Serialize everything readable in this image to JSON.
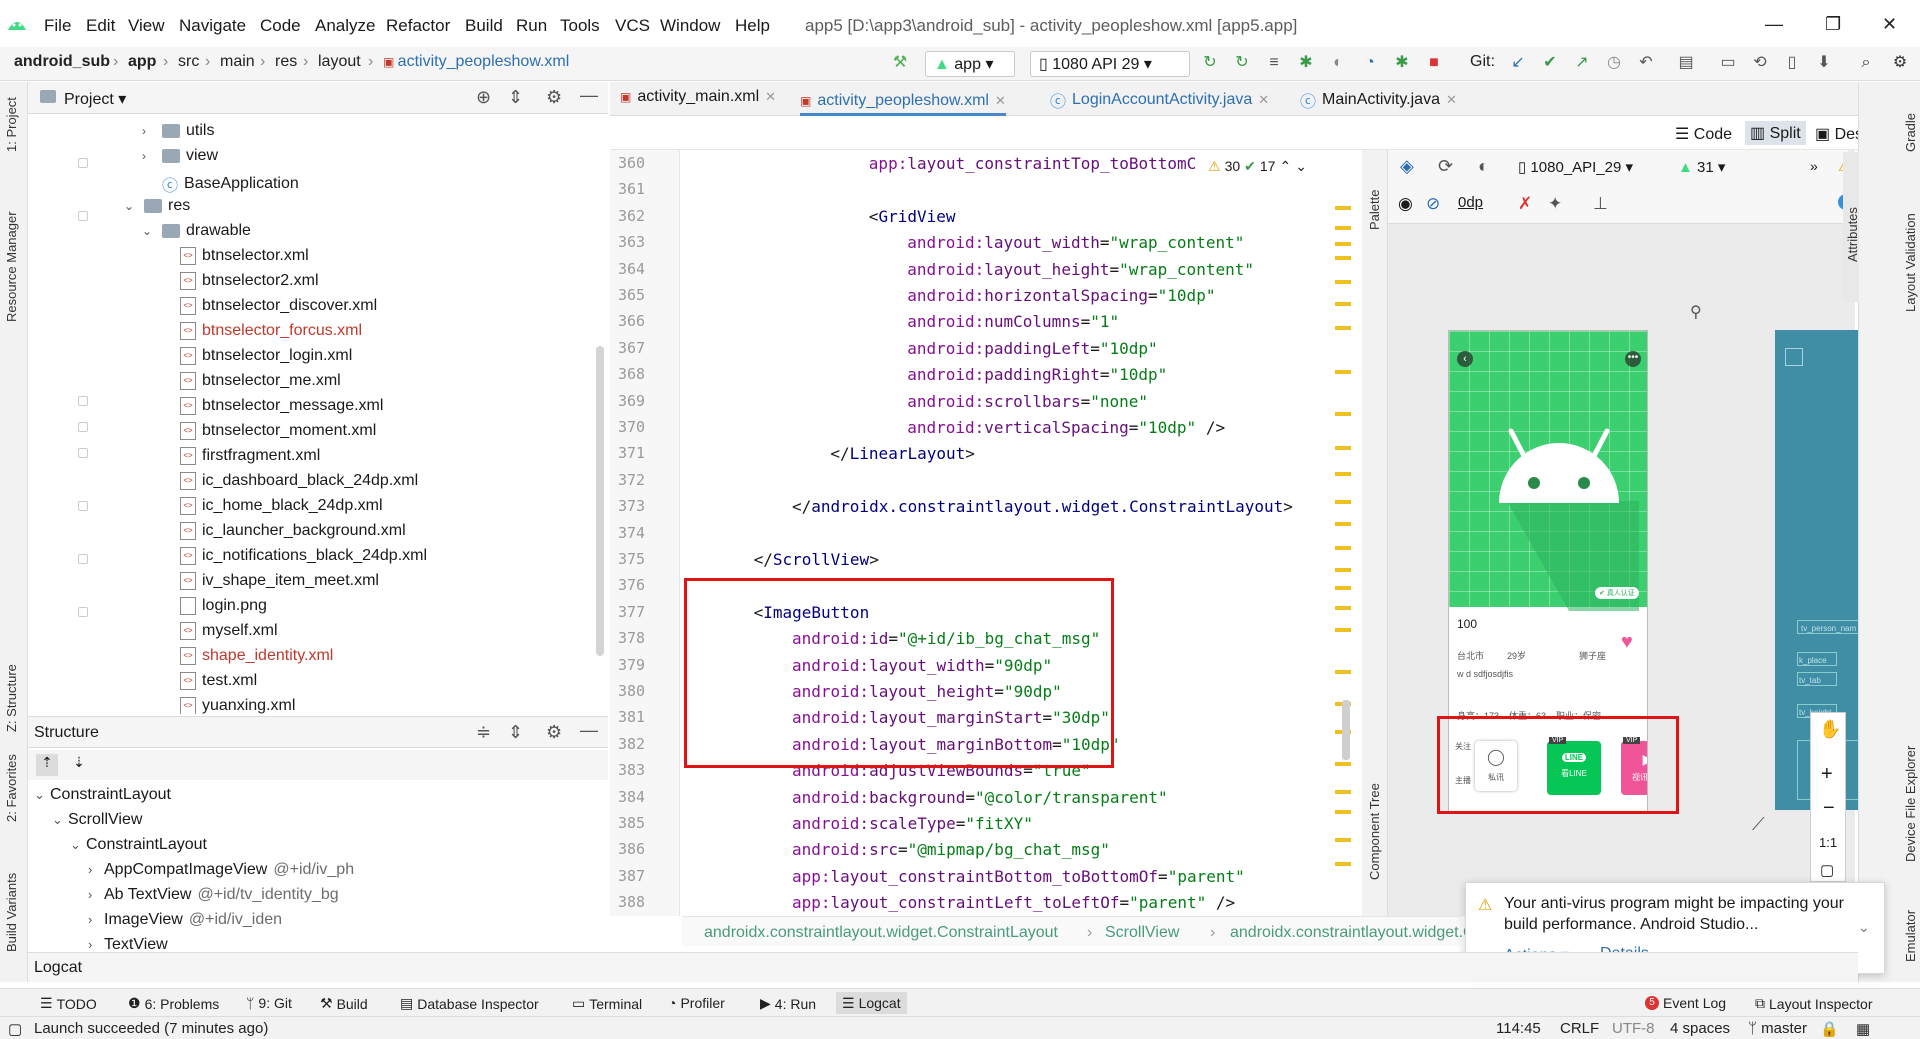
{
  "menubar": {
    "items": [
      "File",
      "Edit",
      "View",
      "Navigate",
      "Code",
      "Analyze",
      "Refactor",
      "Build",
      "Run",
      "Tools",
      "VCS",
      "Window",
      "Help"
    ],
    "window_title": "app5 [D:\\app3\\android_sub] - activity_peopleshow.xml [app5.app]"
  },
  "breadcrumb": {
    "items": [
      "android_sub",
      "app",
      "src",
      "main",
      "res",
      "layout",
      "activity_peopleshow.xml"
    ]
  },
  "toolbar": {
    "run_config": "app",
    "device": "1080 API 29",
    "git_label": "Git:"
  },
  "project": {
    "header": "Project",
    "tree": [
      {
        "label": "utils",
        "type": "folder",
        "indent": 1,
        "arrow": ">"
      },
      {
        "label": "view",
        "type": "folder",
        "indent": 1,
        "arrow": ">"
      },
      {
        "label": "BaseApplication",
        "type": "class",
        "indent": 1,
        "arrow": ""
      },
      {
        "label": "res",
        "type": "folder",
        "indent": 0,
        "arrow": "v"
      },
      {
        "label": "drawable",
        "type": "folder",
        "indent": 1,
        "arrow": "v"
      },
      {
        "label": "btnselector.xml",
        "type": "xml",
        "indent": 2,
        "arrow": ""
      },
      {
        "label": "btnselector2.xml",
        "type": "xml",
        "indent": 2,
        "arrow": ""
      },
      {
        "label": "btnselector_discover.xml",
        "type": "xml",
        "indent": 2,
        "arrow": ""
      },
      {
        "label": "btnselector_forcus.xml",
        "type": "xml",
        "indent": 2,
        "arrow": "",
        "error": true
      },
      {
        "label": "btnselector_login.xml",
        "type": "xml",
        "indent": 2,
        "arrow": ""
      },
      {
        "label": "btnselector_me.xml",
        "type": "xml",
        "indent": 2,
        "arrow": ""
      },
      {
        "label": "btnselector_message.xml",
        "type": "xml",
        "indent": 2,
        "arrow": ""
      },
      {
        "label": "btnselector_moment.xml",
        "type": "xml",
        "indent": 2,
        "arrow": ""
      },
      {
        "label": "firstfragment.xml",
        "type": "xml",
        "indent": 2,
        "arrow": ""
      },
      {
        "label": "ic_dashboard_black_24dp.xml",
        "type": "xml",
        "indent": 2,
        "arrow": ""
      },
      {
        "label": "ic_home_black_24dp.xml",
        "type": "xml",
        "indent": 2,
        "arrow": ""
      },
      {
        "label": "ic_launcher_background.xml",
        "type": "xml",
        "indent": 2,
        "arrow": ""
      },
      {
        "label": "ic_notifications_black_24dp.xml",
        "type": "xml",
        "indent": 2,
        "arrow": ""
      },
      {
        "label": "iv_shape_item_meet.xml",
        "type": "xml",
        "indent": 2,
        "arrow": ""
      },
      {
        "label": "login.png",
        "type": "png",
        "indent": 2,
        "arrow": ""
      },
      {
        "label": "myself.xml",
        "type": "xml",
        "indent": 2,
        "arrow": ""
      },
      {
        "label": "shape_identity.xml",
        "type": "xml",
        "indent": 2,
        "arrow": "",
        "error": true
      },
      {
        "label": "test.xml",
        "type": "xml",
        "indent": 2,
        "arrow": ""
      },
      {
        "label": "yuanxing.xml",
        "type": "xml",
        "indent": 2,
        "arrow": ""
      }
    ]
  },
  "structure": {
    "header": "Structure",
    "tree": [
      {
        "label": "ConstraintLayout",
        "id": "",
        "indent": 0,
        "arrow": "v"
      },
      {
        "label": "ScrollView",
        "id": "",
        "indent": 1,
        "arrow": "v"
      },
      {
        "label": "ConstraintLayout",
        "id": "",
        "indent": 2,
        "arrow": "v"
      },
      {
        "label": "AppCompatImageView",
        "id": "@+id/iv_ph",
        "indent": 3,
        "arrow": ">"
      },
      {
        "label": "Ab TextView",
        "id": "@+id/tv_identity_bg",
        "indent": 3,
        "arrow": ">"
      },
      {
        "label": "ImageView",
        "id": "@+id/iv_iden",
        "indent": 3,
        "arrow": ">"
      },
      {
        "label": "TextView",
        "id": "",
        "indent": 3,
        "arrow": ">"
      }
    ]
  },
  "editor": {
    "tabs": [
      {
        "label": "activity_main.xml",
        "active": false
      },
      {
        "label": "activity_peopleshow.xml",
        "active": true
      },
      {
        "label": "LoginAccountActivity.java",
        "active": false
      },
      {
        "label": "MainActivity.java",
        "active": false
      }
    ],
    "modes": [
      "Code",
      "Split",
      "Design"
    ],
    "inspection": {
      "warnings": "30",
      "weak_warnings": "17"
    },
    "lines": [
      {
        "n": "360",
        "indent": 18,
        "parts": [
          [
            "ns",
            "app:"
          ],
          [
            "attr",
            "layout_constraintTop_toBottomC"
          ]
        ]
      },
      {
        "n": "361",
        "indent": 0,
        "parts": []
      },
      {
        "n": "362",
        "indent": 18,
        "parts": [
          [
            "pl",
            "<"
          ],
          [
            "tag",
            "GridView"
          ]
        ]
      },
      {
        "n": "363",
        "indent": 22,
        "parts": [
          [
            "ns",
            "android:"
          ],
          [
            "attr",
            "layout_width"
          ],
          [
            "pl",
            "="
          ],
          [
            "str",
            "\"wrap_content\""
          ]
        ]
      },
      {
        "n": "364",
        "indent": 22,
        "parts": [
          [
            "ns",
            "android:"
          ],
          [
            "attr",
            "layout_height"
          ],
          [
            "pl",
            "="
          ],
          [
            "str",
            "\"wrap_content\""
          ]
        ]
      },
      {
        "n": "365",
        "indent": 22,
        "parts": [
          [
            "ns",
            "android:"
          ],
          [
            "attr",
            "horizontalSpacing"
          ],
          [
            "pl",
            "="
          ],
          [
            "str",
            "\"10dp\""
          ]
        ]
      },
      {
        "n": "366",
        "indent": 22,
        "parts": [
          [
            "ns",
            "android:"
          ],
          [
            "attr",
            "numColumns"
          ],
          [
            "pl",
            "="
          ],
          [
            "str",
            "\"1\""
          ]
        ]
      },
      {
        "n": "367",
        "indent": 22,
        "parts": [
          [
            "ns",
            "android:"
          ],
          [
            "attr",
            "paddingLeft"
          ],
          [
            "pl",
            "="
          ],
          [
            "str",
            "\"10dp\""
          ]
        ]
      },
      {
        "n": "368",
        "indent": 22,
        "parts": [
          [
            "ns",
            "android:"
          ],
          [
            "attr",
            "paddingRight"
          ],
          [
            "pl",
            "="
          ],
          [
            "str",
            "\"10dp\""
          ]
        ]
      },
      {
        "n": "369",
        "indent": 22,
        "parts": [
          [
            "ns",
            "android:"
          ],
          [
            "attr",
            "scrollbars"
          ],
          [
            "pl",
            "="
          ],
          [
            "str",
            "\"none\""
          ]
        ]
      },
      {
        "n": "370",
        "indent": 22,
        "parts": [
          [
            "ns",
            "android:"
          ],
          [
            "attr",
            "verticalSpacing"
          ],
          [
            "pl",
            "="
          ],
          [
            "str",
            "\"10dp\""
          ],
          [
            "pl",
            " />"
          ]
        ]
      },
      {
        "n": "371",
        "indent": 14,
        "parts": [
          [
            "pl",
            "</"
          ],
          [
            "tag",
            "LinearLayout"
          ],
          [
            "pl",
            ">"
          ]
        ]
      },
      {
        "n": "372",
        "indent": 0,
        "parts": []
      },
      {
        "n": "373",
        "indent": 10,
        "parts": [
          [
            "pl",
            "</"
          ],
          [
            "tag",
            "androidx.constraintlayout.widget.ConstraintLayout"
          ],
          [
            "pl",
            ">"
          ]
        ]
      },
      {
        "n": "374",
        "indent": 0,
        "parts": []
      },
      {
        "n": "375",
        "indent": 6,
        "parts": [
          [
            "pl",
            "</"
          ],
          [
            "tag",
            "ScrollView"
          ],
          [
            "pl",
            ">"
          ]
        ]
      },
      {
        "n": "376",
        "indent": 0,
        "parts": []
      },
      {
        "n": "377",
        "indent": 6,
        "parts": [
          [
            "pl",
            "<"
          ],
          [
            "tag",
            "ImageButton"
          ]
        ]
      },
      {
        "n": "378",
        "indent": 10,
        "parts": [
          [
            "ns",
            "android:"
          ],
          [
            "attr",
            "id"
          ],
          [
            "pl",
            "="
          ],
          [
            "str",
            "\"@+id/ib_bg_chat_msg\""
          ]
        ]
      },
      {
        "n": "379",
        "indent": 10,
        "parts": [
          [
            "ns",
            "android:"
          ],
          [
            "attr",
            "layout_width"
          ],
          [
            "pl",
            "="
          ],
          [
            "str",
            "\"90dp\""
          ]
        ]
      },
      {
        "n": "380",
        "indent": 10,
        "parts": [
          [
            "ns",
            "android:"
          ],
          [
            "attr",
            "layout_height"
          ],
          [
            "pl",
            "="
          ],
          [
            "str",
            "\"90dp\""
          ]
        ]
      },
      {
        "n": "381",
        "indent": 10,
        "parts": [
          [
            "ns",
            "android:"
          ],
          [
            "attr",
            "layout_marginStart"
          ],
          [
            "pl",
            "="
          ],
          [
            "str",
            "\"30dp\""
          ]
        ]
      },
      {
        "n": "382",
        "indent": 10,
        "parts": [
          [
            "ns",
            "android:"
          ],
          [
            "attr",
            "layout_marginBottom"
          ],
          [
            "pl",
            "="
          ],
          [
            "str",
            "\"10dp\""
          ]
        ]
      },
      {
        "n": "383",
        "indent": 10,
        "parts": [
          [
            "ns",
            "android:"
          ],
          [
            "attr",
            "adjustViewBounds"
          ],
          [
            "pl",
            "="
          ],
          [
            "str",
            "\"true\""
          ]
        ]
      },
      {
        "n": "384",
        "indent": 10,
        "parts": [
          [
            "ns",
            "android:"
          ],
          [
            "attr",
            "background"
          ],
          [
            "pl",
            "="
          ],
          [
            "str",
            "\"@color/transparent\""
          ]
        ]
      },
      {
        "n": "385",
        "indent": 10,
        "parts": [
          [
            "ns",
            "android:"
          ],
          [
            "attr",
            "scaleType"
          ],
          [
            "pl",
            "="
          ],
          [
            "str",
            "\"fitXY\""
          ]
        ]
      },
      {
        "n": "386",
        "indent": 10,
        "parts": [
          [
            "ns",
            "android:"
          ],
          [
            "attr",
            "src"
          ],
          [
            "pl",
            "="
          ],
          [
            "str",
            "\"@mipmap/bg_chat_msg\""
          ]
        ]
      },
      {
        "n": "387",
        "indent": 10,
        "parts": [
          [
            "ns",
            "app:"
          ],
          [
            "attr",
            "layout_constraintBottom_toBottomOf"
          ],
          [
            "pl",
            "="
          ],
          [
            "str",
            "\"parent\""
          ]
        ]
      },
      {
        "n": "388",
        "indent": 10,
        "parts": [
          [
            "ns",
            "app:"
          ],
          [
            "attr",
            "layout_constraintLeft_toLeftOf"
          ],
          [
            "pl",
            "="
          ],
          [
            "str",
            "\"parent\""
          ],
          [
            "pl",
            " />"
          ]
        ]
      }
    ],
    "breadcrumb": [
      "androidx.constraintlayout.widget.ConstraintLayout",
      "ScrollView",
      "androidx.constraintlayout.widget.C"
    ]
  },
  "design": {
    "device": "1080_API_29",
    "api": "31",
    "zero_dp": "0dp",
    "phone": {
      "badge": "真人认证",
      "count": "100",
      "city": "台北市",
      "age": "29岁",
      "sign": "狮子座",
      "desc": "w d sdfjosdjfis",
      "stats": "身高：173    体重：63    职业：保密",
      "follow": "关注",
      "follow2": "丝",
      "host": "主播",
      "btn_msg": "私讯",
      "btn_line": "看LINE",
      "btn_video": "视讯聊天",
      "vip": "VIP",
      "line_logo": "LINE"
    },
    "blueprint_labels": [
      "tv_person_nam",
      "k_place",
      "tv_tab",
      "tv_height",
      "tv"
    ],
    "zoom_label": "1:1"
  },
  "notification": {
    "text": "Your anti-virus program might be impacting your build performance. Android Studio...",
    "actions": "Actions",
    "details": "Details"
  },
  "sidebars": {
    "left": [
      "1: Project",
      "Resource Manager",
      "Z: Structure",
      "2: Favorites",
      "Build Variants"
    ],
    "right": [
      "Gradle",
      "Layout Validation",
      "Device File Explorer",
      "Emulator"
    ],
    "design_left": [
      "Palette",
      "Component Tree"
    ],
    "design_right": [
      "Attributes"
    ]
  },
  "bottom": {
    "logcat": "Logcat",
    "tools": [
      "TODO",
      "6: Problems",
      "9: Git",
      "Build",
      "Database Inspector",
      "Terminal",
      "Profiler",
      "4: Run",
      "Logcat"
    ],
    "event_log": "Event Log",
    "event_count": "5",
    "layout_inspector": "Layout Inspector"
  },
  "status": {
    "message": "Launch succeeded (7 minutes ago)",
    "position": "114:45",
    "line_sep": "CRLF",
    "encoding": "UTF-8",
    "indent": "4 spaces",
    "branch": "master"
  },
  "colors": {
    "highlight_box": "#e01414",
    "phone_green": "#3ccf6f",
    "line_green": "#06c755",
    "video_pink": "#f0559a",
    "blueprint": "#3f8ea5"
  }
}
